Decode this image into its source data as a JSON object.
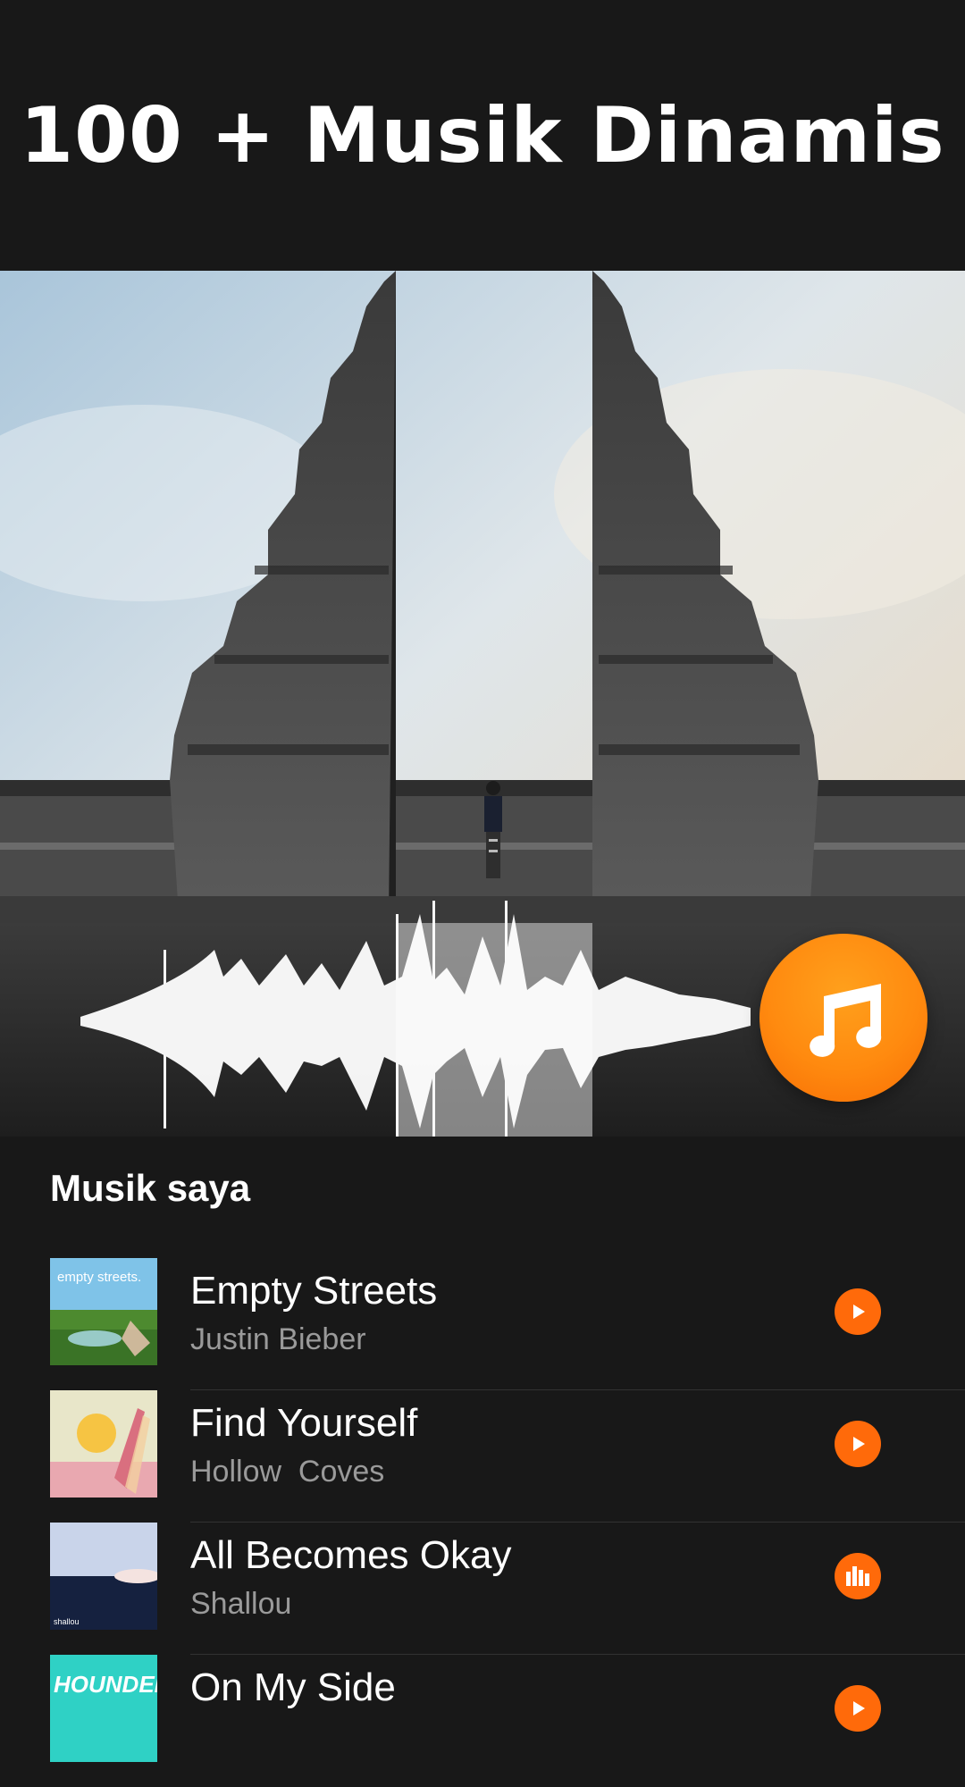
{
  "headline": "100 + Musik Dinamis",
  "hero": {
    "fab_icon": "music-note-icon"
  },
  "section_title": "Musik saya",
  "accent_color": "#ff6a0a",
  "tracks": [
    {
      "title": "Empty Streets",
      "artist": "Justin Bieber",
      "art_text": "empty streets.",
      "state": "play-icon"
    },
    {
      "title": "Find Yourself",
      "artist": "Hollow  Coves",
      "art_text": "",
      "state": "play-icon"
    },
    {
      "title": "All Becomes Okay",
      "artist": "Shallou",
      "art_text": "shallou",
      "state": "equalizer-icon"
    },
    {
      "title": "On My Side",
      "artist": "",
      "art_text": "HOUNDED",
      "state": "play-icon"
    }
  ]
}
